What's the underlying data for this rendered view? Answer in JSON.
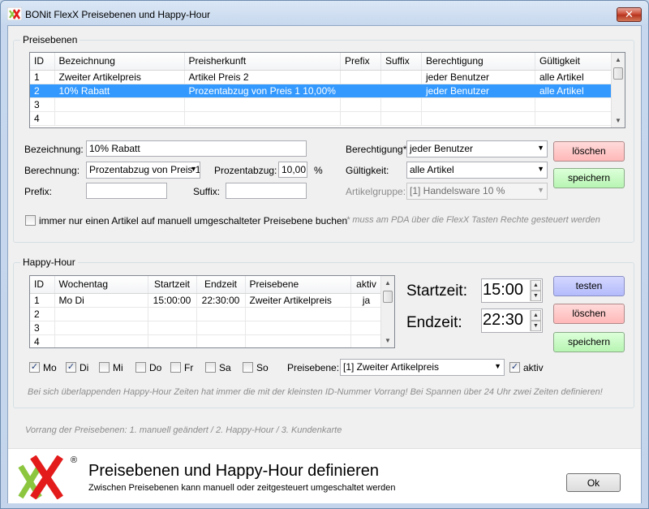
{
  "window": {
    "title": "BONit FlexX Preisebenen und Happy-Hour",
    "close_label": "✕"
  },
  "preisebenen": {
    "group_label": "Preisebenen",
    "columns": [
      "ID",
      "Bezeichnung",
      "Preisherkunft",
      "Prefix",
      "Suffix",
      "Berechtigung",
      "Gültigkeit"
    ],
    "rows": [
      [
        "1",
        "Zweiter Artikelpreis",
        "Artikel Preis 2",
        "",
        "",
        "jeder Benutzer",
        "alle Artikel"
      ],
      [
        "2",
        "10% Rabatt",
        "Prozentabzug von Preis 1 10,00%",
        "",
        "",
        "jeder Benutzer",
        "alle Artikel"
      ],
      [
        "3",
        "",
        "",
        "",
        "",
        "",
        ""
      ],
      [
        "4",
        "",
        "",
        "",
        "",
        "",
        ""
      ]
    ],
    "form": {
      "bezeichnung_label": "Bezeichnung:",
      "bezeichnung_value": "10% Rabatt",
      "berechnung_label": "Berechnung:",
      "berechnung_value": "Prozentabzug von Preis 1",
      "prozentabzug_label": "Prozentabzug:",
      "prozentabzug_value": "10,00",
      "percent_sign": "%",
      "prefix_label": "Prefix:",
      "prefix_value": "",
      "suffix_label": "Suffix:",
      "suffix_value": "",
      "berechtigung_label": "Berechtigung*:",
      "berechtigung_value": "jeder Benutzer",
      "gueltigkeit_label": "Gültigkeit:",
      "gueltigkeit_value": "alle Artikel",
      "artikelgruppe_label": "Artikelgruppe:",
      "artikelgruppe_value": "[1] Handelsware 10 %",
      "checkbox_label": "immer nur einen Artikel auf manuell umgeschalteter Preisebene buchen",
      "checkbox_checked": false,
      "note": "* muss am PDA über die FlexX Tasten Rechte gesteuert werden",
      "delete_label": "löschen",
      "save_label": "speichern"
    }
  },
  "happyhour": {
    "group_label": "Happy-Hour",
    "columns": [
      "ID",
      "Wochentag",
      "Startzeit",
      "Endzeit",
      "Preisebene",
      "aktiv"
    ],
    "rows": [
      [
        "1",
        "Mo Di",
        "15:00:00",
        "22:30:00",
        "Zweiter Artikelpreis",
        "ja"
      ],
      [
        "2",
        "",
        "",
        "",
        "",
        ""
      ],
      [
        "3",
        "",
        "",
        "",
        "",
        ""
      ],
      [
        "4",
        "",
        "",
        "",
        "",
        ""
      ]
    ],
    "startzeit_label": "Startzeit:",
    "startzeit_value": "15:00",
    "endzeit_label": "Endzeit:",
    "endzeit_value": "22:30",
    "test_label": "testen",
    "delete_label": "löschen",
    "save_label": "speichern",
    "days": [
      {
        "label": "Mo",
        "checked": true
      },
      {
        "label": "Di",
        "checked": true
      },
      {
        "label": "Mi",
        "checked": false
      },
      {
        "label": "Do",
        "checked": false
      },
      {
        "label": "Fr",
        "checked": false
      },
      {
        "label": "Sa",
        "checked": false
      },
      {
        "label": "So",
        "checked": false
      }
    ],
    "preisebene_label": "Preisebene:",
    "preisebene_value": "[1] Zweiter Artikelpreis",
    "aktiv_label": "aktiv",
    "aktiv_checked": true,
    "note": "Bei sich überlappenden Happy-Hour Zeiten hat immer die mit der kleinsten ID-Nummer Vorrang! Bei Spannen über 24 Uhr zwei Zeiten definieren!"
  },
  "vorrang_note": "Vorrang der Preisebenen: 1. manuell geändert / 2. Happy-Hour / 3. Kundenkarte",
  "footer": {
    "heading": "Preisebenen und Happy-Hour definieren",
    "subheading": "Zwischen Preisebenen kann manuell oder zeitgesteuert umgeschaltet werden",
    "ok_label": "Ok",
    "registered_mark": "®"
  },
  "colors": {
    "selection": "#3399ff",
    "logo_red": "#e31b1b",
    "logo_green": "#8cc63f",
    "button_red": "#ffb8b8",
    "button_green": "#b8f5b3",
    "button_blue": "#b4bbfb"
  }
}
